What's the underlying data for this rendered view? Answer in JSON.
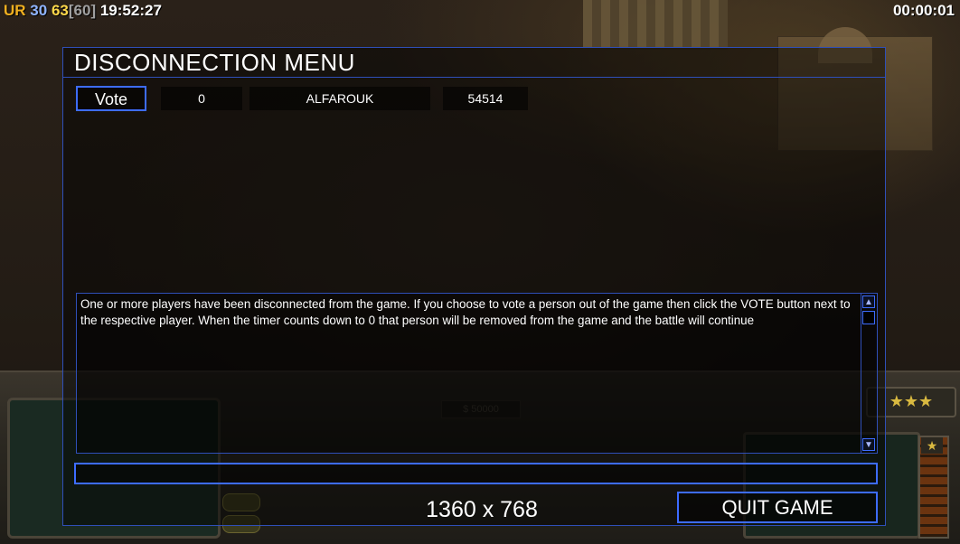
{
  "hud_stats": {
    "prefix": "UR",
    "value1": "30",
    "value2": "63",
    "value3": "[60]",
    "clock": "19:52:27"
  },
  "game_timer": "00:00:01",
  "hud": {
    "money": "$ 50000",
    "stars": "★★★",
    "rank_star": "★"
  },
  "dialog": {
    "title": "DISCONNECTION MENU",
    "players": [
      {
        "vote_label": "Vote",
        "votes": "0",
        "name": "ALFAROUK",
        "ping": "54514"
      }
    ],
    "message": "One or more players have been disconnected from the game. If you choose to vote a person out of the game then click the VOTE button next to the respective player. When the timer counts down to 0 that person will be removed from the game and the battle will continue",
    "chat_value": "",
    "resolution": "1360 x 768",
    "quit_label": "QUIT GAME"
  },
  "colors": {
    "accent_border": "#3d6cff",
    "ur_color": "#f0b020",
    "value1_color": "#8fb4ff",
    "value2_color": "#ffd84a",
    "value3_color": "#a0a0a0"
  }
}
